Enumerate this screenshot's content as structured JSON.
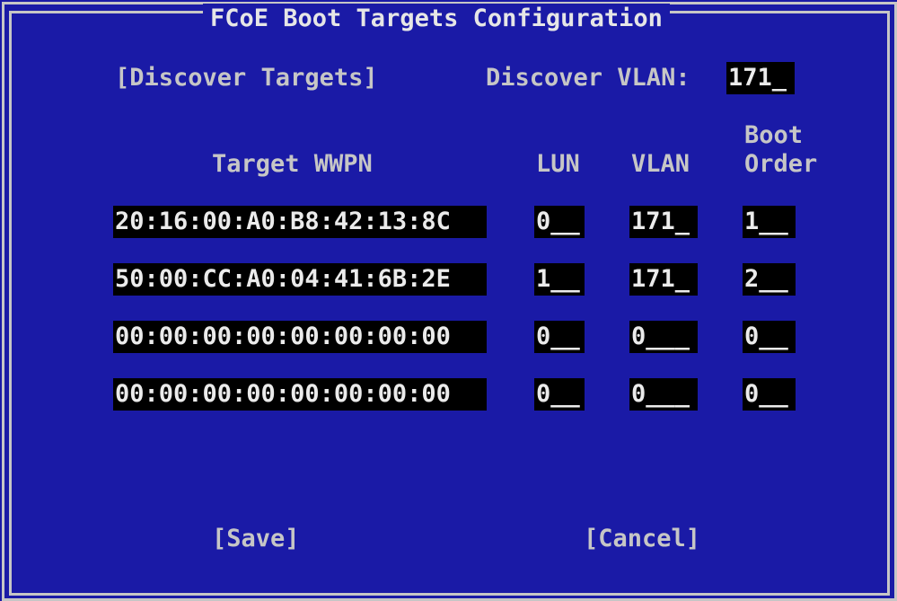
{
  "title": "FCoE Boot Targets Configuration",
  "discover": {
    "button_label": "[Discover Targets]",
    "vlan_label": "Discover VLAN:",
    "vlan_value": "171_"
  },
  "columns": {
    "wwpn": "Target WWPN",
    "lun": "LUN",
    "vlan": "VLAN",
    "boot_order_line1": "Boot",
    "boot_order_line2": "Order"
  },
  "rows": [
    {
      "wwpn": "20:16:00:A0:B8:42:13:8C",
      "lun": "0__",
      "vlan": "171_",
      "boot_order": "1__"
    },
    {
      "wwpn": "50:00:CC:A0:04:41:6B:2E",
      "lun": "1__",
      "vlan": "171_",
      "boot_order": "2__"
    },
    {
      "wwpn": "00:00:00:00:00:00:00:00",
      "lun": "0__",
      "vlan": "0___",
      "boot_order": "0__"
    },
    {
      "wwpn": "00:00:00:00:00:00:00:00",
      "lun": "0__",
      "vlan": "0___",
      "boot_order": "0__"
    }
  ],
  "actions": {
    "save_label": "[Save]",
    "cancel_label": "[Cancel]"
  },
  "colors": {
    "background": "#1a1aa6",
    "text": "#c6c6c6",
    "field_background": "#000000"
  }
}
